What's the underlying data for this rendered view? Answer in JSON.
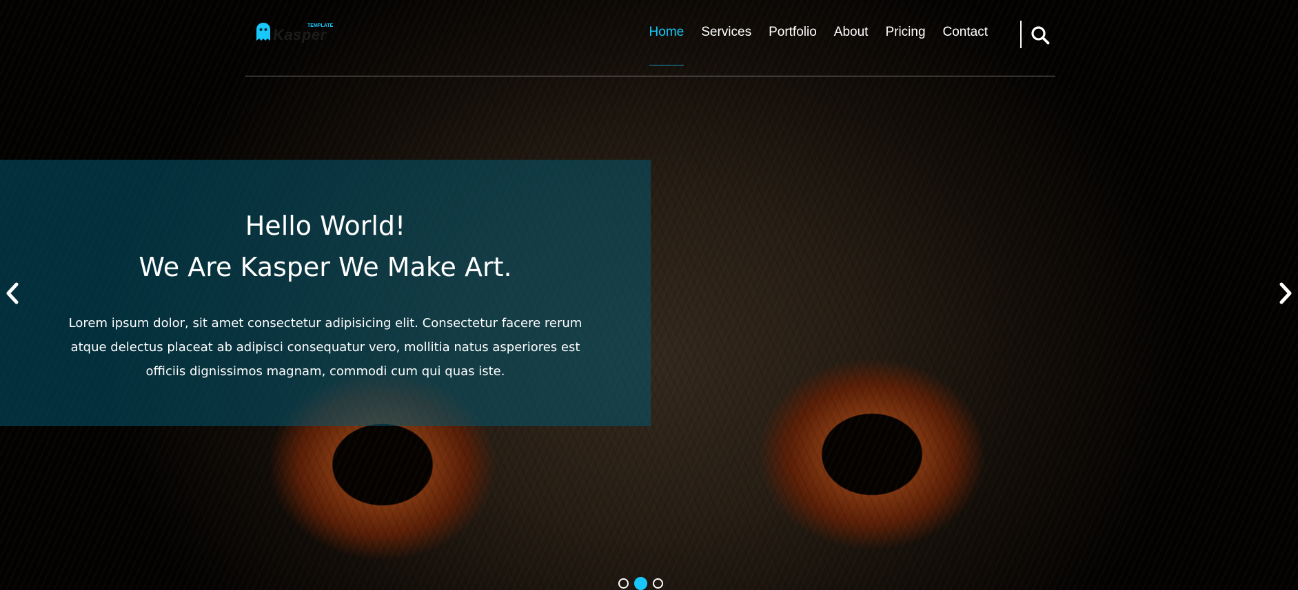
{
  "header": {
    "logo_text": "Kasper",
    "logo_tag": "TEMPLATE",
    "nav": [
      {
        "label": "Home",
        "active": true
      },
      {
        "label": "Services",
        "active": false
      },
      {
        "label": "Portfolio",
        "active": false
      },
      {
        "label": "About",
        "active": false
      },
      {
        "label": "Pricing",
        "active": false
      },
      {
        "label": "Contact",
        "active": false
      }
    ]
  },
  "hero": {
    "title_line1": "Hello World!",
    "title_line2": "We Are Kasper We Make Art.",
    "description": "Lorem ipsum dolor, sit amet consectetur adipisicing elit. Consectetur facere rerum atque delectus placeat ab adipisci consequatur vero, mollitia natus asperiores est officiis dignissimos magnam, commodi cum qui quas iste.",
    "slides": 3,
    "active_slide": 2
  },
  "icons": {
    "logo": "ghost-icon",
    "search": "search-icon",
    "prev": "chevron-left-icon",
    "next": "chevron-right-icon"
  },
  "colors": {
    "accent": "#19c8fa",
    "panel": "#04556e"
  }
}
